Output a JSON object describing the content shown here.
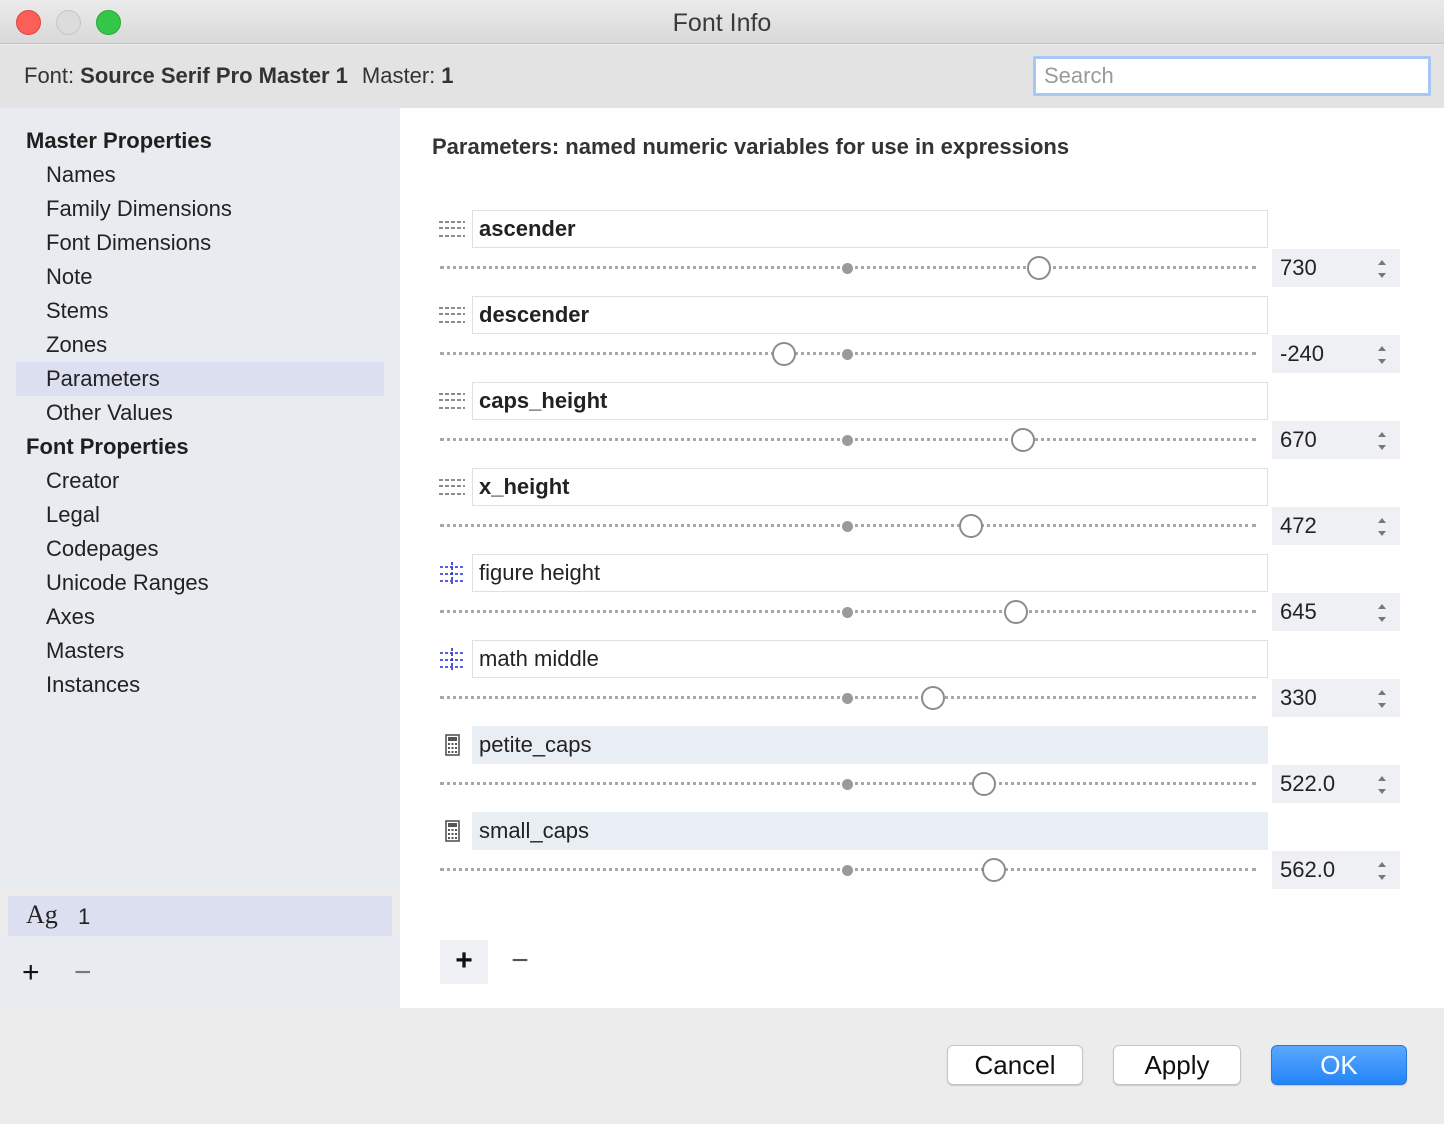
{
  "window": {
    "title": "Font Info"
  },
  "header": {
    "font_label": "Font:",
    "font_name": "Source Serif Pro Master 1",
    "master_label": "Master:",
    "master_value": "1",
    "search_placeholder": "Search"
  },
  "sidebar": {
    "group1": "Master Properties",
    "items1": [
      "Names",
      "Family Dimensions",
      "Font Dimensions",
      "Note",
      "Stems",
      "Zones",
      "Parameters",
      "Other Values"
    ],
    "group2": "Font Properties",
    "items2": [
      "Creator",
      "Legal",
      "Codepages",
      "Unicode Ranges",
      "Axes",
      "Masters",
      "Instances"
    ],
    "selected": "Parameters",
    "master_row": {
      "glyph": "Ag",
      "number": "1"
    },
    "add_label": "+",
    "remove_label": "−"
  },
  "main": {
    "title": "Parameters: named numeric variables for use in expressions",
    "parameters": [
      {
        "name": "ascender",
        "value": "730",
        "kind": "metric",
        "icon": "dashed-lines-icon"
      },
      {
        "name": "descender",
        "value": "-240",
        "kind": "metric",
        "icon": "dashed-lines-icon"
      },
      {
        "name": "caps_height",
        "value": "670",
        "kind": "metric",
        "icon": "dashed-lines-icon"
      },
      {
        "name": "x_height",
        "value": "472",
        "kind": "metric",
        "icon": "dashed-lines-icon"
      },
      {
        "name": "figure height",
        "value": "645",
        "kind": "guide",
        "icon": "crosshair-guide-icon"
      },
      {
        "name": "math middle",
        "value": "330",
        "kind": "guide",
        "icon": "crosshair-guide-icon"
      },
      {
        "name": "petite_caps",
        "value": "522.0",
        "kind": "expression",
        "icon": "calculator-icon"
      },
      {
        "name": "small_caps",
        "value": "562.0",
        "kind": "expression",
        "icon": "calculator-icon"
      }
    ],
    "add_label": "+",
    "remove_label": "−"
  },
  "footer": {
    "cancel": "Cancel",
    "apply": "Apply",
    "ok": "OK"
  },
  "colors": {
    "accent": "#2485f8",
    "sidebar_bg": "#e8ebef",
    "selection": "#dcdff0",
    "close": "#fc5f57",
    "zoom": "#33c748"
  }
}
